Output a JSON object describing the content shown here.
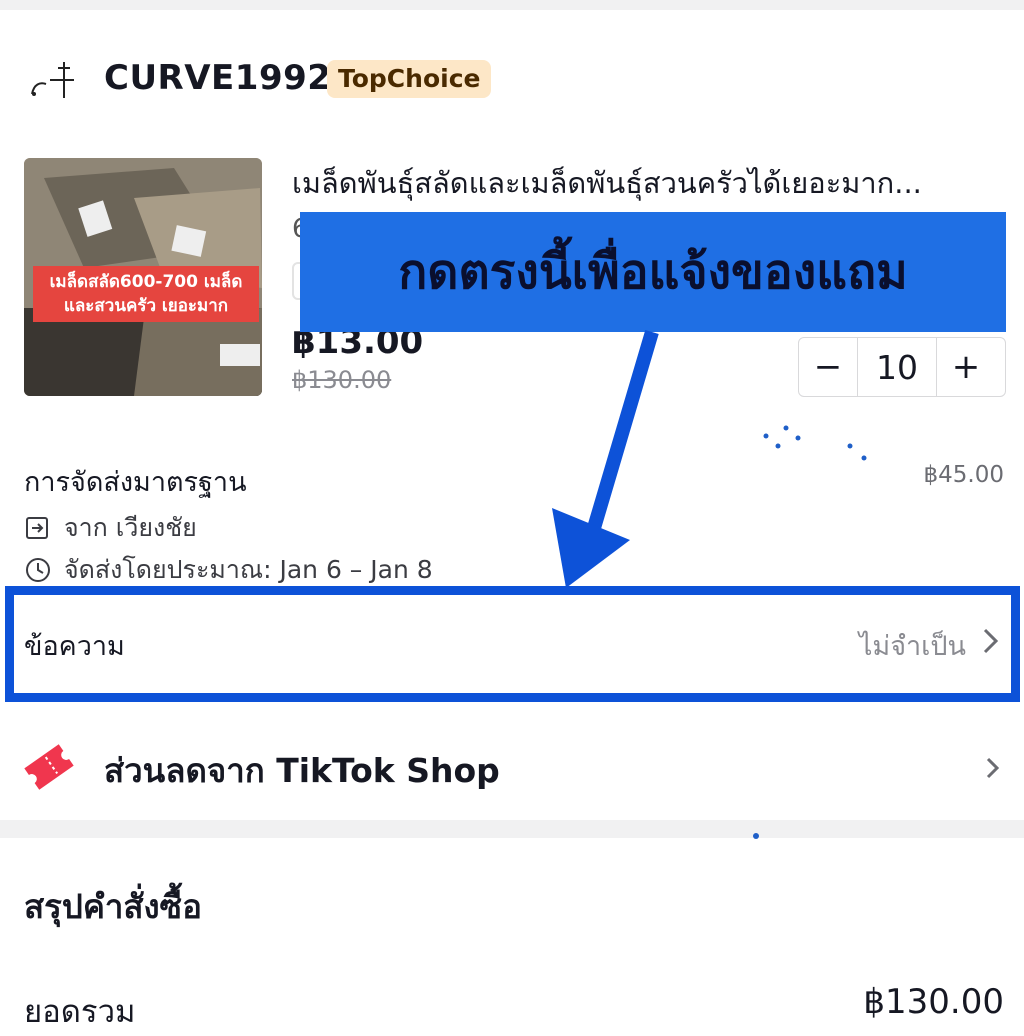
{
  "shop": {
    "name": "CURVE1992",
    "badge": "TopChoice"
  },
  "product": {
    "title": "เมล็ดพันธุ์สลัดและเมล็ดพันธุ์สวนครัวได้เยอะมาก...",
    "title_line2_fragment": "6",
    "image_label_line1": "เมล็ดสลัด600-700 เมล็ด",
    "image_label_line2": "และสวนครัว เยอะมาก",
    "price": "฿13.00",
    "original_price": "฿130.00",
    "quantity": "10",
    "minus_label": "−",
    "plus_label": "+"
  },
  "annotation": {
    "banner_text": "กดตรงนี้เพื่อแจ้งของแถม",
    "color": "#1f6fe4"
  },
  "shipping": {
    "title": "การจัดส่งมาตรฐาน",
    "cost": "฿45.00",
    "from": "จาก เวียงชัย",
    "eta": "จัดส่งโดยประมาณ: Jan 6 – Jan 8"
  },
  "message": {
    "label": "ข้อความ",
    "value": "ไม่จำเป็น"
  },
  "discount": {
    "label": "ส่วนลดจาก TikTok Shop",
    "icon_color": "#f0364e"
  },
  "summary": {
    "title": "สรุปคำสั่งซื้อ",
    "subtotal_label": "ยอดรวม",
    "subtotal_value": "฿130.00"
  }
}
